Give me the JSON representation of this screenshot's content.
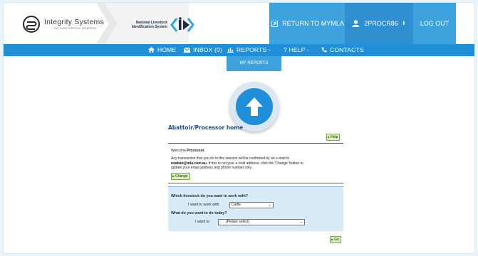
{
  "header": {
    "logo_name": "Integrity Systems",
    "logo_tagline": "red meat customer assurance",
    "nlis_line1": "National Livestock",
    "nlis_line2": "Identification System",
    "return_label": "RETURN TO MYMLA",
    "user_label": "2PROCR86",
    "logout_label": "LOG OUT"
  },
  "nav": {
    "home": "HOME",
    "inbox": "INBOX (0)",
    "reports": "REPORTS -",
    "help": "? HELP -",
    "contacts": "CONTACTS"
  },
  "dropdown": {
    "my_reports": "MY REPORTS"
  },
  "page": {
    "title": "Abattoir/Processor home",
    "help_button": "Help",
    "welcome_prefix": "Welcome",
    "welcome_name": "Processor.",
    "info_line1": "Any transaction that you do in this session will be confirmed by an e-mail to",
    "info_email": "rwahab@mla.com.au",
    "info_line2": ". If this is not your e-mail address, click the 'Change' button to",
    "info_line3": "update your email address and phone number only.",
    "change_button": "Change"
  },
  "form": {
    "q_livestock": "Which livestock do you want to work with?",
    "work_with_label": "I want to work with",
    "livestock_value": "Cattle",
    "q_today": "What do you want to do today?",
    "want_to_label": "I want to",
    "action_value": "(Please select)",
    "go_button": "Go"
  },
  "colors": {
    "nav_blue": "#1e8fd8",
    "button_blue": "#3ea3dc",
    "user_blue": "#2f8fd0",
    "title_blue": "#1c4c8a",
    "form_bg": "#d8ecf8",
    "button_green": "#d9efbf"
  }
}
